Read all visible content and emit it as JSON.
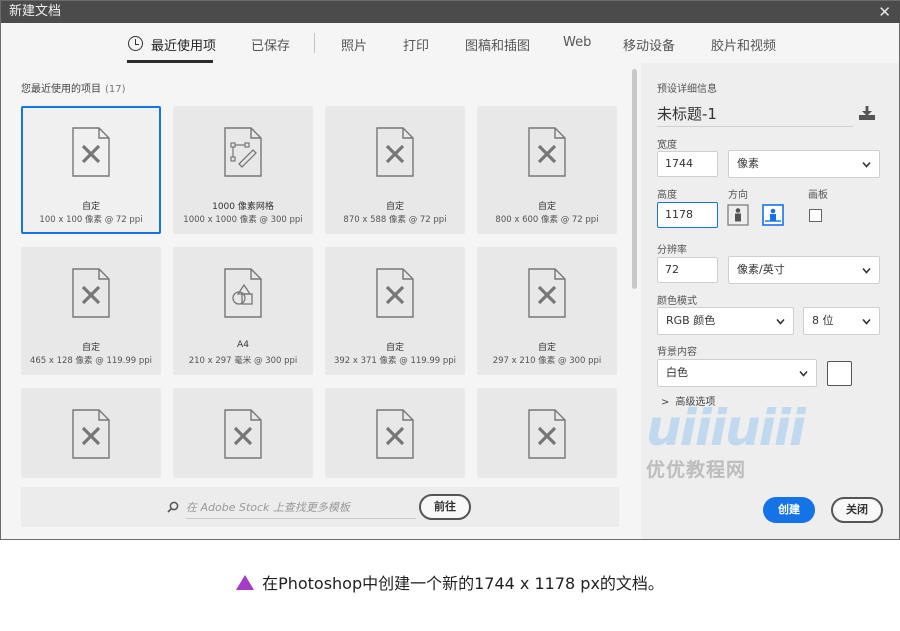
{
  "window": {
    "title": "新建文档",
    "close_glyph": "✕"
  },
  "tabs": [
    {
      "label": "最近使用项",
      "active": true,
      "icon": "clock-icon"
    },
    {
      "label": "已保存"
    },
    {
      "label": "照片"
    },
    {
      "label": "打印"
    },
    {
      "label": "图稿和插图"
    },
    {
      "label": "Web"
    },
    {
      "label": "移动设备"
    },
    {
      "label": "胶片和视频"
    }
  ],
  "recent": {
    "title": "您最近使用的项目",
    "count": "(17)",
    "items": [
      {
        "name": "自定",
        "size": "100 x 100 像素 @ 72 ppi",
        "icon": "document-pencil-icon",
        "selected": true
      },
      {
        "name": "1000 像素网格",
        "size": "1000 x 1000 像素 @ 300 ppi",
        "icon": "document-pen-path-icon"
      },
      {
        "name": "自定",
        "size": "870 x 588 像素 @ 72 ppi",
        "icon": "document-pencil-icon"
      },
      {
        "name": "自定",
        "size": "800 x 600 像素 @ 72 ppi",
        "icon": "document-pencil-icon"
      },
      {
        "name": "自定",
        "size": "465 x 128 像素 @ 119.99 ppi",
        "icon": "document-pencil-icon"
      },
      {
        "name": "A4",
        "size": "210 x 297 毫米 @ 300 ppi",
        "icon": "document-shapes-icon"
      },
      {
        "name": "自定",
        "size": "392 x 371 像素 @ 119.99 ppi",
        "icon": "document-pencil-icon"
      },
      {
        "name": "自定",
        "size": "297 x 210 像素 @ 300 ppi",
        "icon": "document-pencil-icon"
      },
      {
        "name": "",
        "size": "",
        "icon": "document-pencil-icon"
      },
      {
        "name": "",
        "size": "",
        "icon": "document-pencil-icon"
      },
      {
        "name": "",
        "size": "",
        "icon": "document-pencil-icon"
      },
      {
        "name": "",
        "size": "",
        "icon": "document-pencil-icon"
      }
    ]
  },
  "search": {
    "placeholder": "在 Adobe Stock 上查找更多模板",
    "go_label": "前往"
  },
  "preset": {
    "section_label": "预设详细信息",
    "doc_name": "未标题-1",
    "width_label": "宽度",
    "width_value": "1744",
    "width_unit": "像素",
    "height_label": "高度",
    "height_value": "1178",
    "orientation_label": "方向",
    "artboard_label": "画板",
    "artboard_checked": false,
    "resolution_label": "分辨率",
    "resolution_value": "72",
    "resolution_unit": "像素/英寸",
    "color_mode_label": "颜色模式",
    "color_mode": "RGB 颜色",
    "bit_depth": "8 位",
    "background_label": "背景内容",
    "background": "白色",
    "background_swatch": "#ffffff",
    "advanced_label": "高级选项"
  },
  "buttons": {
    "create": "创建",
    "close": "关闭"
  },
  "watermark": {
    "logo": "uiiiuiii",
    "sub": "优优教程网"
  },
  "caption": "在Photoshop中创建一个新的1744 x 1178 px的文档。",
  "colors": {
    "accent": "#1473e6",
    "caption_marker": "#a43cc8",
    "titlebar": "#4b4b4b"
  }
}
